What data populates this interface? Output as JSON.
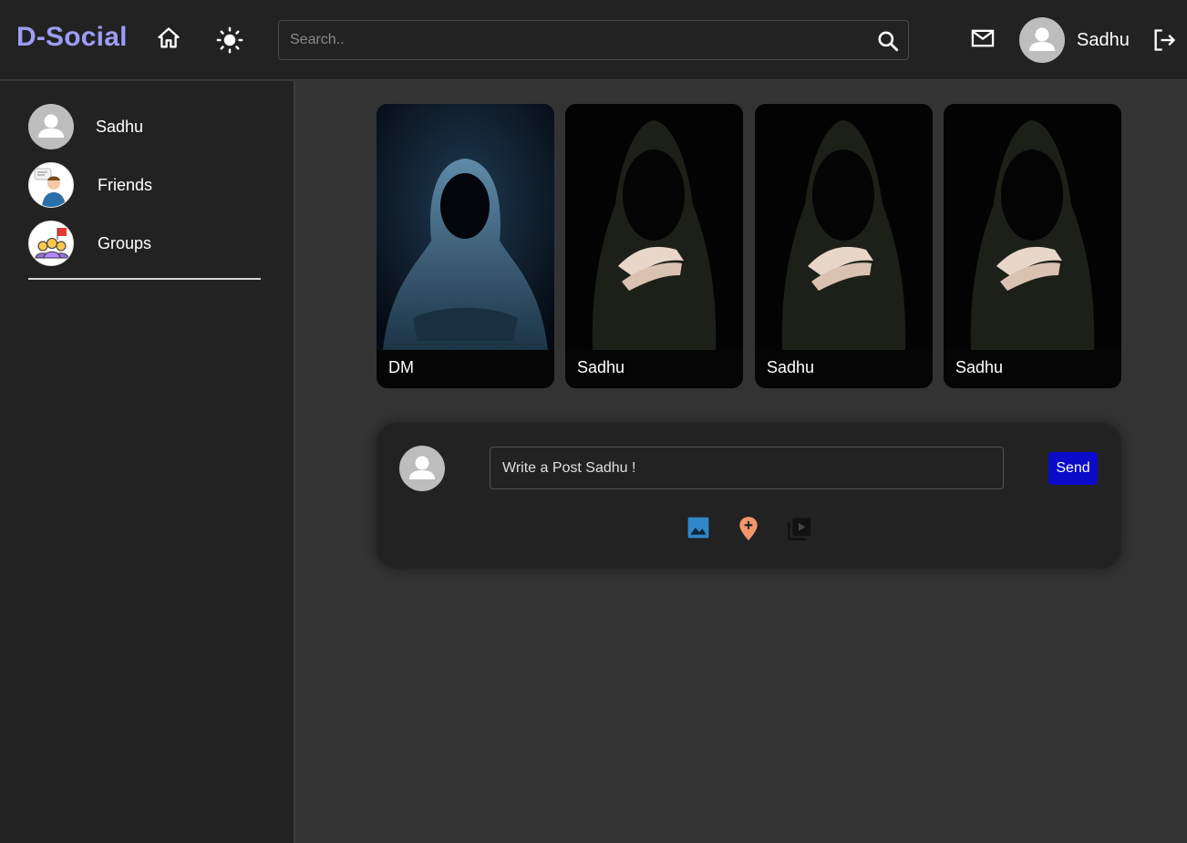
{
  "app": {
    "logo": "D-Social",
    "logo_color": "#9e9cf5"
  },
  "navbar": {
    "search_placeholder": "Search..",
    "username": "Sadhu",
    "icons": [
      "home-icon",
      "brightness-icon",
      "search-icon",
      "mail-icon",
      "avatar",
      "logout-icon"
    ]
  },
  "sidebar": {
    "items": [
      {
        "label": "Sadhu",
        "icon": "user-avatar"
      },
      {
        "label": "Friends",
        "icon": "friends-icon"
      },
      {
        "label": "Groups",
        "icon": "groups-icon"
      }
    ]
  },
  "stories": [
    {
      "name": "DM"
    },
    {
      "name": "Sadhu"
    },
    {
      "name": "Sadhu"
    },
    {
      "name": "Sadhu"
    }
  ],
  "composer": {
    "placeholder": "Write a Post Sadhu !",
    "send_label": "Send",
    "send_color": "#0a0ac8",
    "tools": [
      {
        "icon": "image-icon",
        "color": "#2f86c8"
      },
      {
        "icon": "add-location-icon",
        "color": "#f4956a"
      },
      {
        "icon": "video-library-icon",
        "color": "#111111"
      }
    ]
  }
}
